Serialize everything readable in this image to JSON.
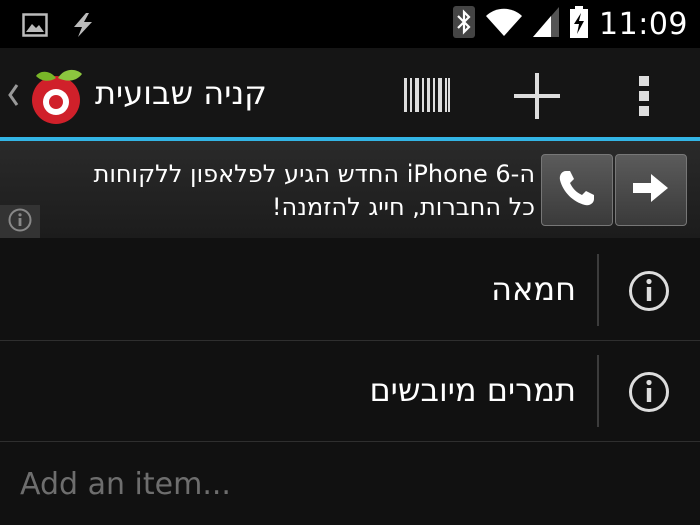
{
  "status_bar": {
    "time": "11:09",
    "notification_icons": [
      "picture-icon",
      "lightning-icon"
    ],
    "system_icons": [
      "bluetooth-icon",
      "wifi-icon",
      "signal-icon",
      "battery-charging-icon"
    ]
  },
  "action_bar": {
    "title": "קניה שבועית",
    "logo": "app-logo-fruit",
    "actions": [
      "barcode-icon",
      "plus-icon",
      "overflow-menu-icon"
    ]
  },
  "colors": {
    "accent": "#33b5e5",
    "background": "#111111",
    "logo_red": "#d0202a",
    "logo_green": "#79b628"
  },
  "ad": {
    "line1": "ה-iPhone 6 החדש הגיע לפלאפון ללקוחות",
    "line2": "כל החברות, חייג להזמנה!",
    "buttons": [
      "phone-icon",
      "arrow-right-icon"
    ],
    "info_icon": "info-icon"
  },
  "list": {
    "items": [
      {
        "label": "חמאה"
      },
      {
        "label": "תמרים מיובשים"
      }
    ]
  },
  "add_item": {
    "placeholder": "Add an item..."
  }
}
